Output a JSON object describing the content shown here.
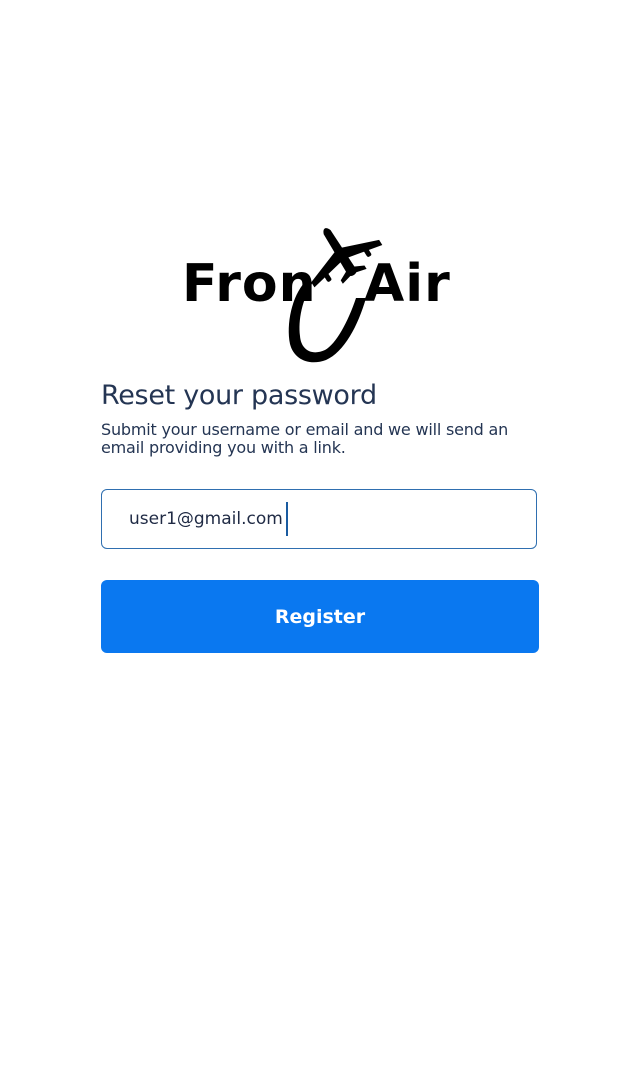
{
  "brand": {
    "logo_text_left": "Fron",
    "logo_text_right": "Air",
    "logo_color": "#000000"
  },
  "reset": {
    "title": "Reset your password",
    "subtitle": "Submit your username or email and we will send an email providing you with a link."
  },
  "form": {
    "email_value": "user1@gmail.com",
    "submit_label": "Register"
  },
  "colors": {
    "primary": "#0a78f0",
    "text": "#243553",
    "input_border": "#2f6fb0"
  }
}
